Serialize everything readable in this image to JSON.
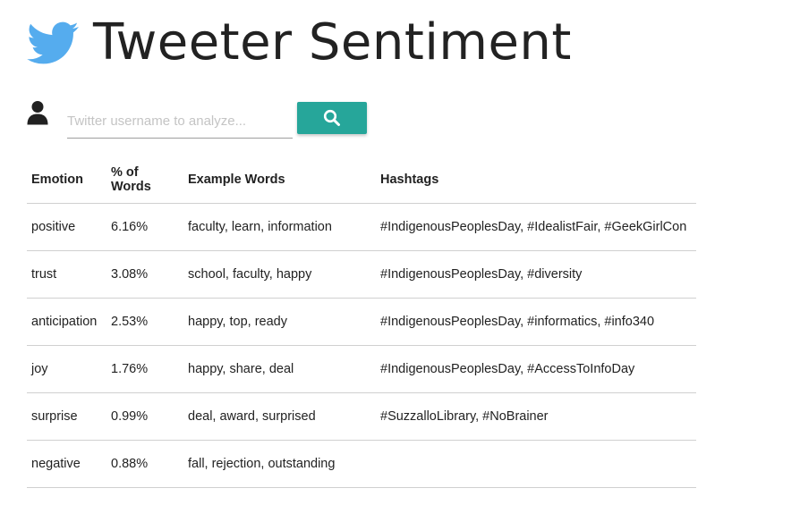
{
  "header": {
    "title": "Tweeter Sentiment",
    "logo_icon": "twitter-bird-icon",
    "logo_color": "#55acee"
  },
  "search": {
    "user_icon": "user-icon",
    "placeholder": "Twitter username to analyze...",
    "value": "",
    "button_icon": "search-icon",
    "button_color": "#26a69a"
  },
  "table": {
    "columns": [
      "Emotion",
      "% of Words",
      "Example Words",
      "Hashtags"
    ],
    "rows": [
      [
        "positive",
        "6.16%",
        "faculty, learn, information",
        "#IndigenousPeoplesDay, #IdealistFair, #GeekGirlCon"
      ],
      [
        "trust",
        "3.08%",
        "school, faculty, happy",
        "#IndigenousPeoplesDay, #diversity"
      ],
      [
        "anticipation",
        "2.53%",
        "happy, top, ready",
        "#IndigenousPeoplesDay, #informatics, #info340"
      ],
      [
        "joy",
        "1.76%",
        "happy, share, deal",
        "#IndigenousPeoplesDay, #AccessToInfoDay"
      ],
      [
        "surprise",
        "0.99%",
        "deal, award, surprised",
        "#SuzzalloLibrary, #NoBrainer"
      ],
      [
        "negative",
        "0.88%",
        "fall, rejection, outstanding",
        ""
      ]
    ]
  }
}
